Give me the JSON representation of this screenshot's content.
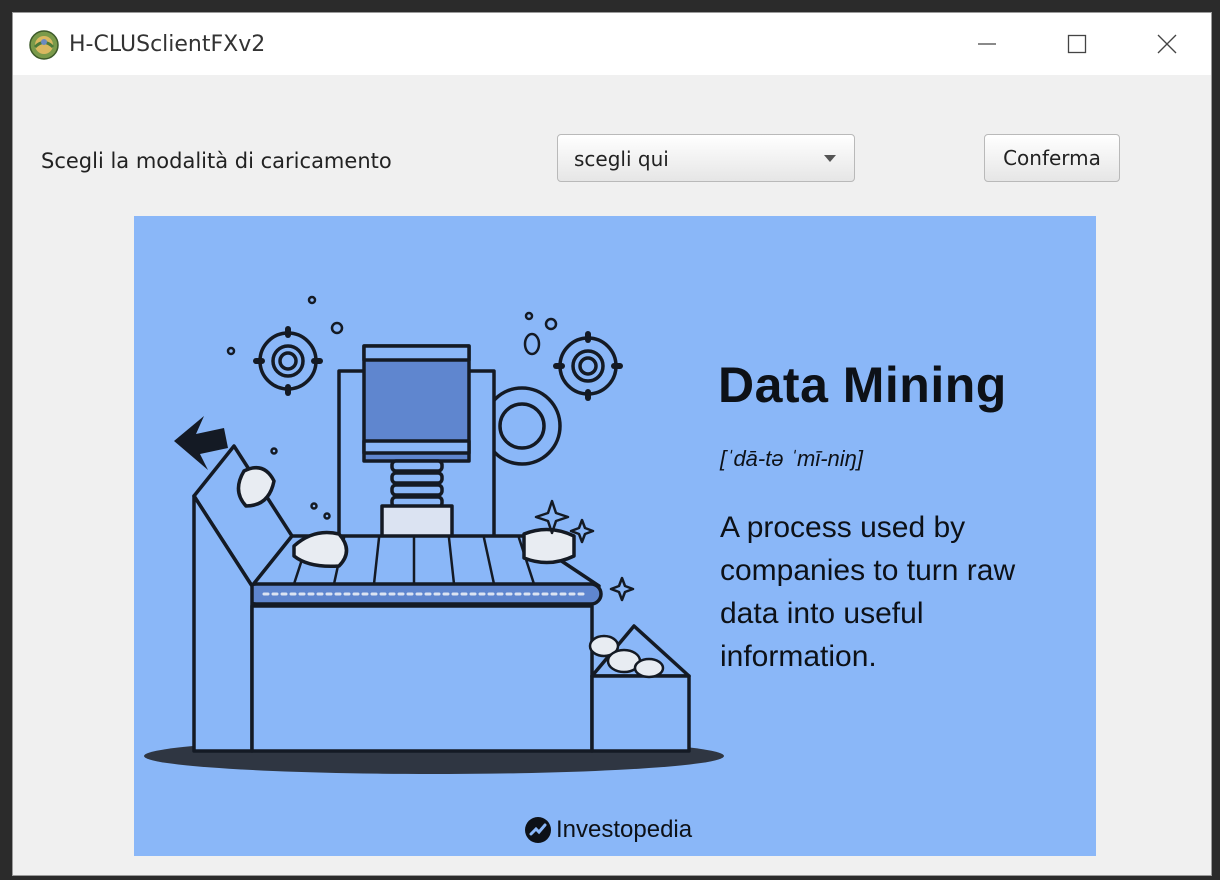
{
  "window": {
    "title": "H-CLUSclientFXv2",
    "app_icon": "globe-app-icon",
    "controls": [
      "minimize-icon",
      "maximize-icon",
      "close-icon"
    ]
  },
  "form": {
    "mode_label": "Scegli la modalità di caricamento",
    "mode_select_value": "scegli qui",
    "confirm_label": "Conferma"
  },
  "banner": {
    "title": "Data Mining",
    "pronunciation": "[ˈdā-tə ˈmī-niŋ]",
    "description": "A process used by companies to turn raw data into useful information.",
    "brand": "Investopedia",
    "background_color": "#8ab7f8",
    "illustration": "data-mining-machine-illustration"
  }
}
